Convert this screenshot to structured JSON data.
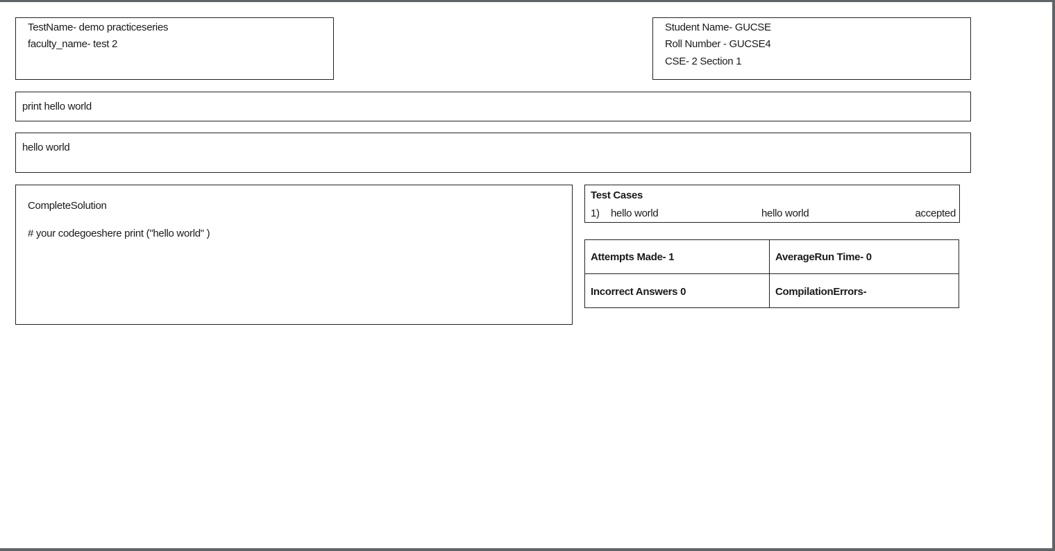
{
  "test_info": {
    "test_name": "TestName- demo practiceseries",
    "faculty_name": "faculty_name- test 2"
  },
  "student_info": {
    "student_name": "Student Name- GUCSE",
    "roll_number": "Roll Number - GUCSE4",
    "section": "CSE- 2 Section 1"
  },
  "question": {
    "text": "print hello world"
  },
  "expected_output": {
    "text": "hello world"
  },
  "solution": {
    "heading": "CompleteSolution",
    "code": "# your codegoeshere print (\"hello world\" )"
  },
  "test_cases": {
    "heading": "Test Cases",
    "rows": [
      {
        "index": "1)",
        "input": "hello world",
        "output": "hello world",
        "status": "accepted"
      }
    ]
  },
  "stats": {
    "attempts_made": "Attempts Made- 1",
    "average_run_time": "AverageRun Time- 0",
    "incorrect_answers": "Incorrect Answers 0",
    "compilation_errors": "CompilationErrors-"
  }
}
